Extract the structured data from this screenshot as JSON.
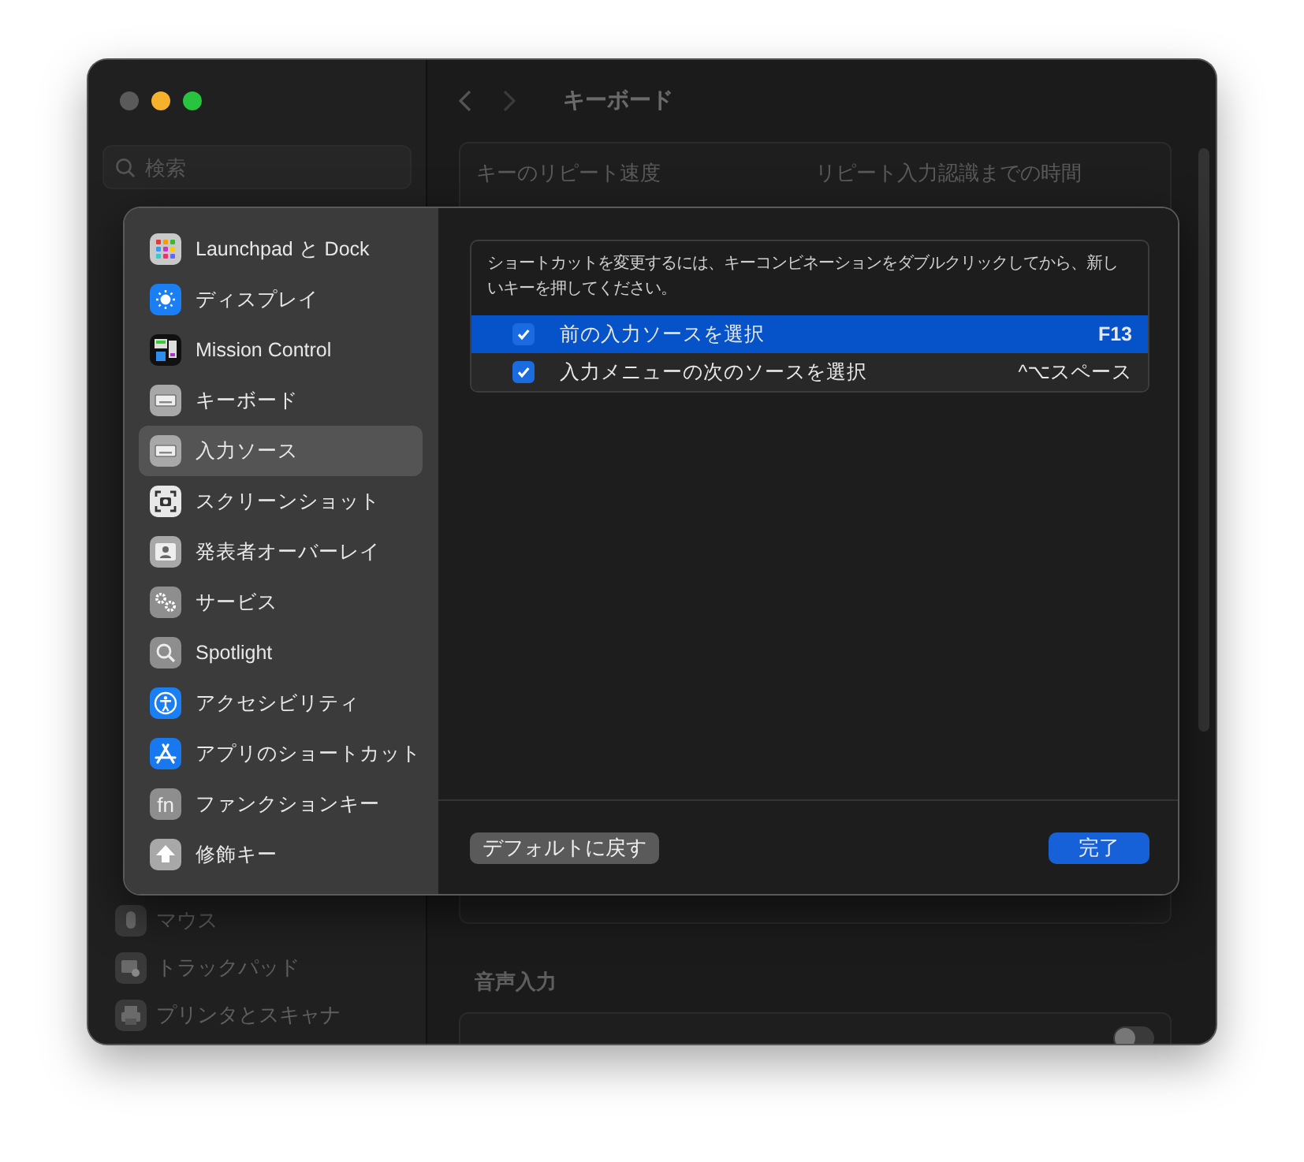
{
  "window": {
    "title": "キーボード"
  },
  "sidebar": {
    "search_placeholder": "検索",
    "items": [
      {
        "label": "マウス",
        "kind": "mouse"
      },
      {
        "label": "トラックパッド",
        "kind": "trackpad"
      },
      {
        "label": "プリンタとスキャナ",
        "kind": "printer"
      }
    ]
  },
  "content": {
    "repeat_labels": [
      "キーのリピート速度",
      "リピート入力認識までの時間"
    ],
    "voice_section": {
      "title": "音声入力",
      "toggle_on": false
    }
  },
  "sheet": {
    "categories": [
      {
        "label": "Launchpad と Dock",
        "kind": "launchpad",
        "selected": false
      },
      {
        "label": "ディスプレイ",
        "kind": "display",
        "selected": false
      },
      {
        "label": "Mission Control",
        "kind": "mission",
        "selected": false
      },
      {
        "label": "キーボード",
        "kind": "keyboard",
        "selected": false
      },
      {
        "label": "入力ソース",
        "kind": "keyboard",
        "selected": true
      },
      {
        "label": "スクリーンショット",
        "kind": "screenshot",
        "selected": false
      },
      {
        "label": "発表者オーバーレイ",
        "kind": "presenter",
        "selected": false
      },
      {
        "label": "サービス",
        "kind": "services",
        "selected": false
      },
      {
        "label": "Spotlight",
        "kind": "spotlight",
        "selected": false
      },
      {
        "label": "アクセシビリティ",
        "kind": "accessibility",
        "selected": false
      },
      {
        "label": "アプリのショートカット",
        "kind": "appstore",
        "selected": false
      },
      {
        "label": "ファンクションキー",
        "kind": "fn",
        "icon_text": "fn",
        "selected": false
      },
      {
        "label": "修飾キー",
        "kind": "modifier",
        "selected": false
      }
    ],
    "description": "ショートカットを変更するには、キーコンビネーションをダブルクリックしてから、新しいキーを押してください。",
    "shortcuts": [
      {
        "label": "前の入力ソースを選択",
        "keys": "F13",
        "checked": true,
        "selected": true
      },
      {
        "label": "入力メニューの次のソースを選択",
        "keys": "^⌥スペース",
        "checked": true,
        "selected": false
      }
    ],
    "buttons": [
      {
        "label": "デフォルトに戻す",
        "kind": "secondary"
      },
      {
        "label": "完了",
        "kind": "primary"
      }
    ]
  }
}
